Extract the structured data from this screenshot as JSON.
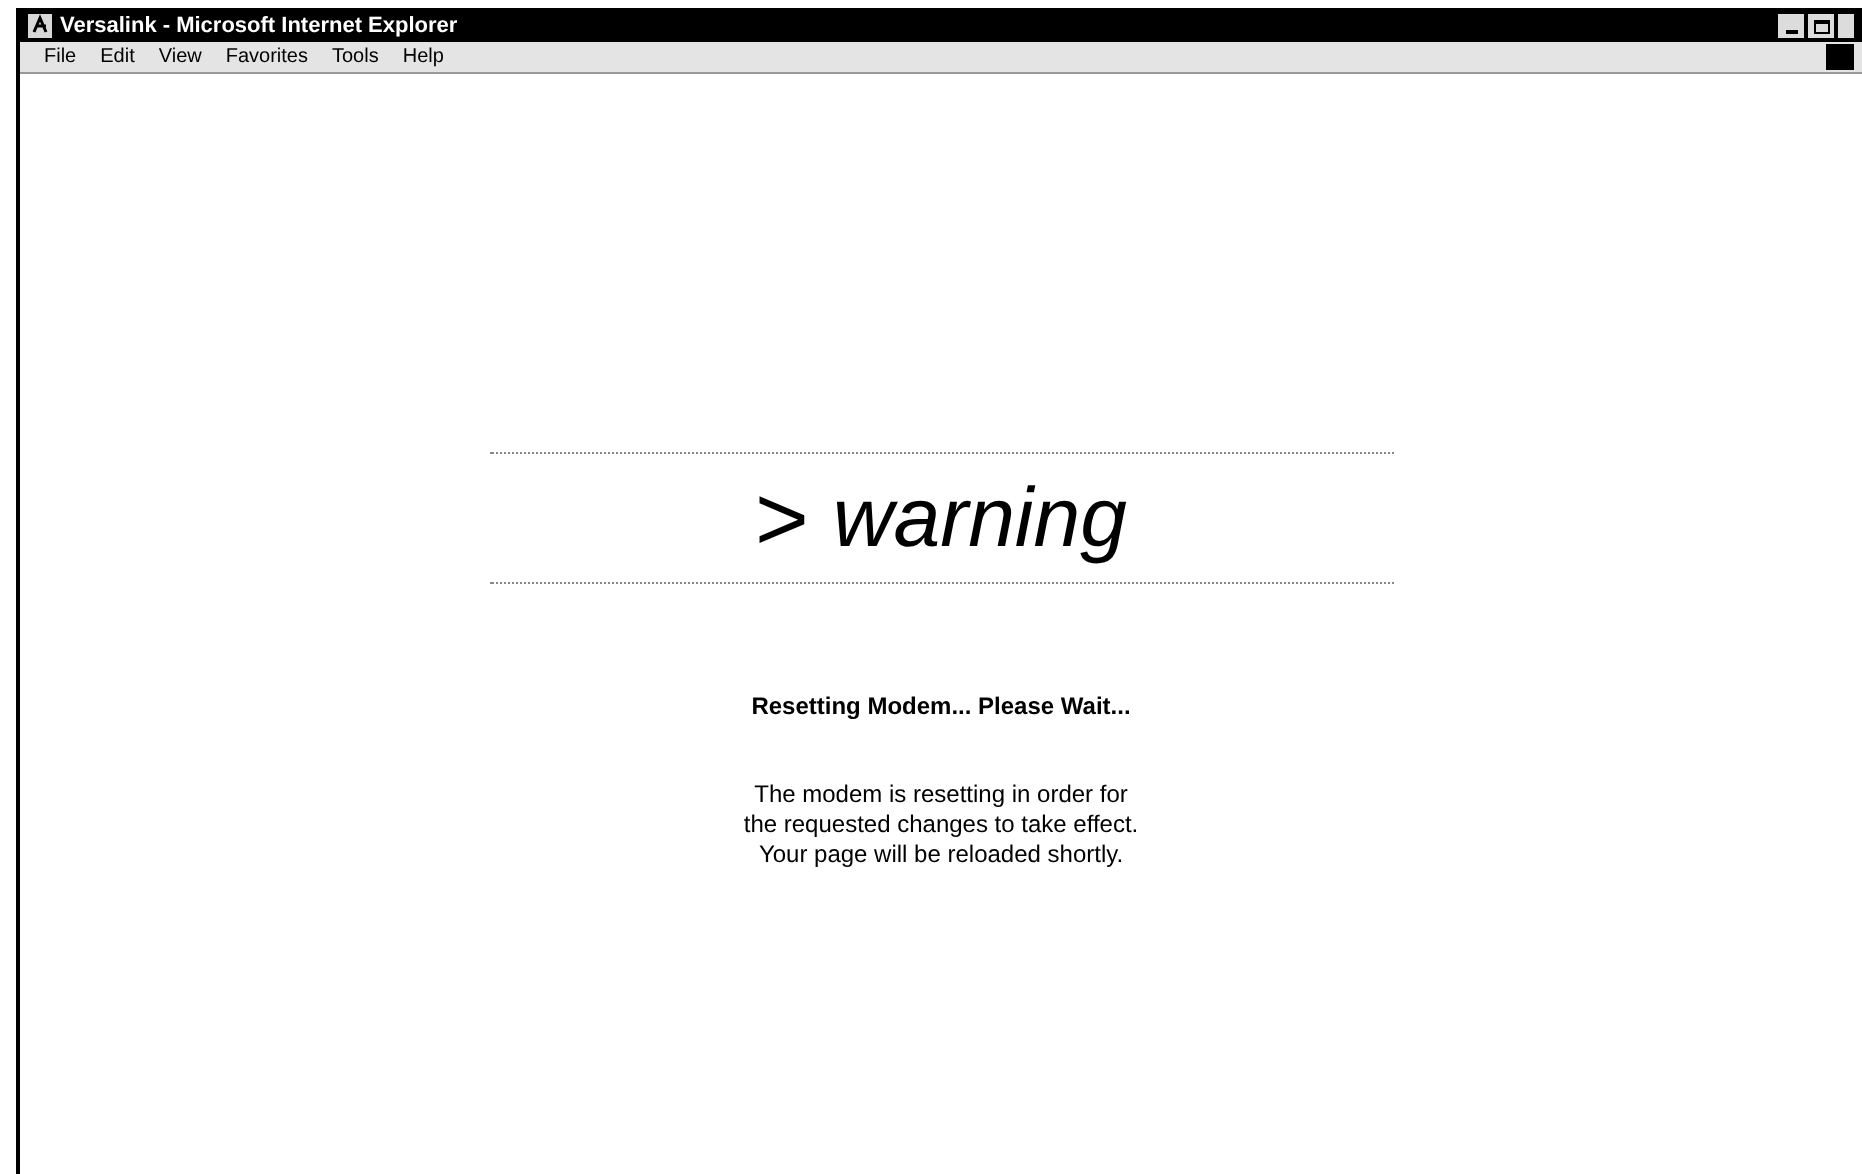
{
  "window": {
    "title": "Versalink - Microsoft Internet Explorer"
  },
  "menu": [
    "File",
    "Edit",
    "View",
    "Favorites",
    "Tools",
    "Help"
  ],
  "page": {
    "arrow": ">",
    "heading": "warning",
    "status": "Resetting Modem... Please Wait...",
    "message": [
      "The modem is resetting in order for",
      "the requested changes to take effect.",
      "Your page will be reloaded shortly."
    ]
  }
}
